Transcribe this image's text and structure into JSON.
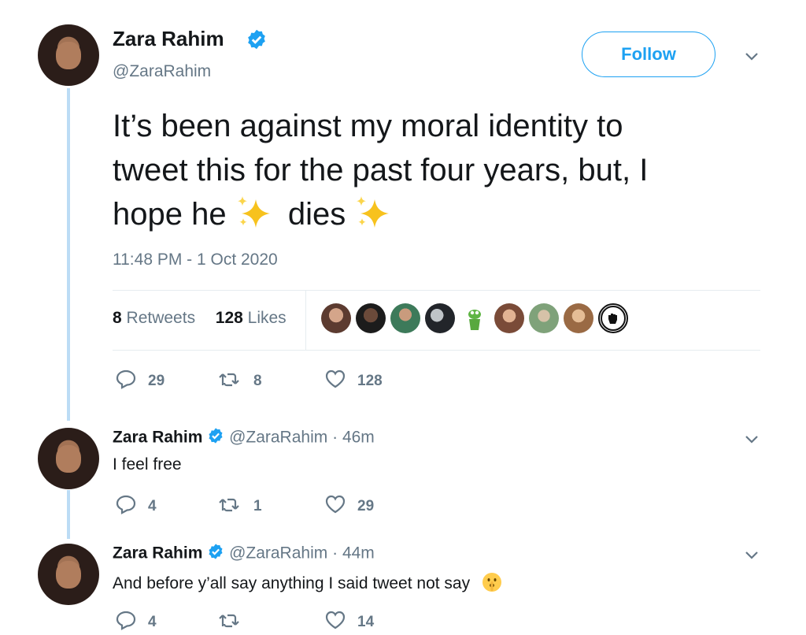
{
  "tweet": {
    "author_name": "Zara Rahim",
    "author_handle": "@ZaraRahim",
    "follow_label": "Follow",
    "text_line1": "It’s been against my moral identity to",
    "text_line2": "tweet this for the past four years, but, I",
    "text_line3_a": "hope he",
    "text_line3_b": "dies",
    "emoji": "sparkles",
    "timestamp": "11:48 PM - 1 Oct 2020",
    "retweets_count": "8",
    "retweets_label": "Retweets",
    "likes_count": "128",
    "likes_label": "Likes",
    "reply_count": "29",
    "retweet_count": "8",
    "like_count": "128",
    "colors": {
      "accent": "#1da1f2",
      "thread": "#bcdcf5",
      "muted": "#657786"
    }
  },
  "replies": [
    {
      "author_name": "Zara Rahim",
      "author_handle": "@ZaraRahim",
      "separator": "·",
      "time": "46m",
      "text": "I feel free",
      "reply_count": "4",
      "retweet_count": "1",
      "like_count": "29"
    },
    {
      "author_name": "Zara Rahim",
      "author_handle": "@ZaraRahim",
      "separator": "·",
      "time": "44m",
      "text": "And before y’all say anything I said tweet not say",
      "emoji": "shushing-face",
      "reply_count": "4",
      "retweet_count": "",
      "like_count": "14"
    }
  ]
}
